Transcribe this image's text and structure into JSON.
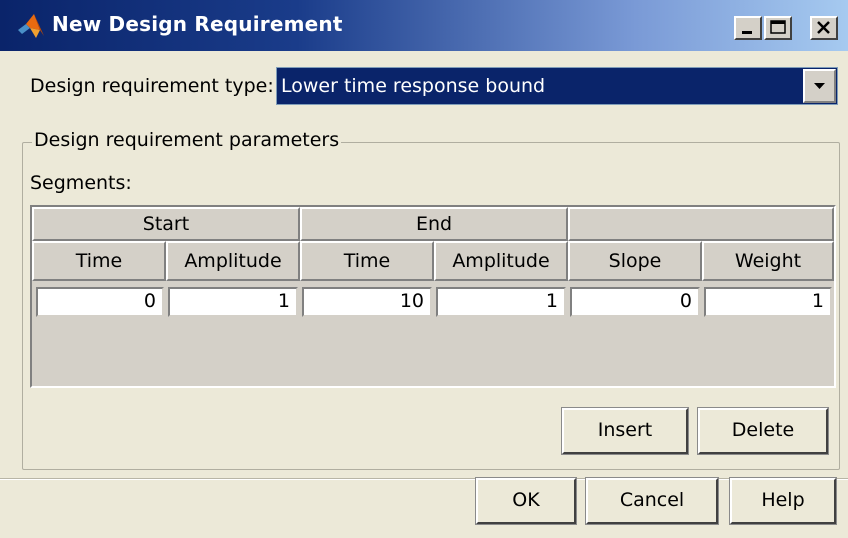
{
  "window": {
    "title": "New Design Requirement",
    "icon": "matlab-icon",
    "controls": [
      "minimize-icon",
      "maximize-icon",
      "close-icon"
    ]
  },
  "type_row": {
    "label": "Design requirement type:",
    "selected": "Lower time response bound"
  },
  "params": {
    "group_label": "Design requirement parameters",
    "segments_label": "Segments:",
    "table": {
      "group_headers": [
        "Start",
        "End",
        ""
      ],
      "columns": [
        "Time",
        "Amplitude",
        "Time",
        "Amplitude",
        "Slope",
        "Weight"
      ],
      "rows": [
        [
          "0",
          "1",
          "10",
          "1",
          "0",
          "1"
        ]
      ]
    },
    "insert_label": "Insert",
    "delete_label": "Delete"
  },
  "footer": {
    "ok_label": "OK",
    "cancel_label": "Cancel",
    "help_label": "Help"
  }
}
